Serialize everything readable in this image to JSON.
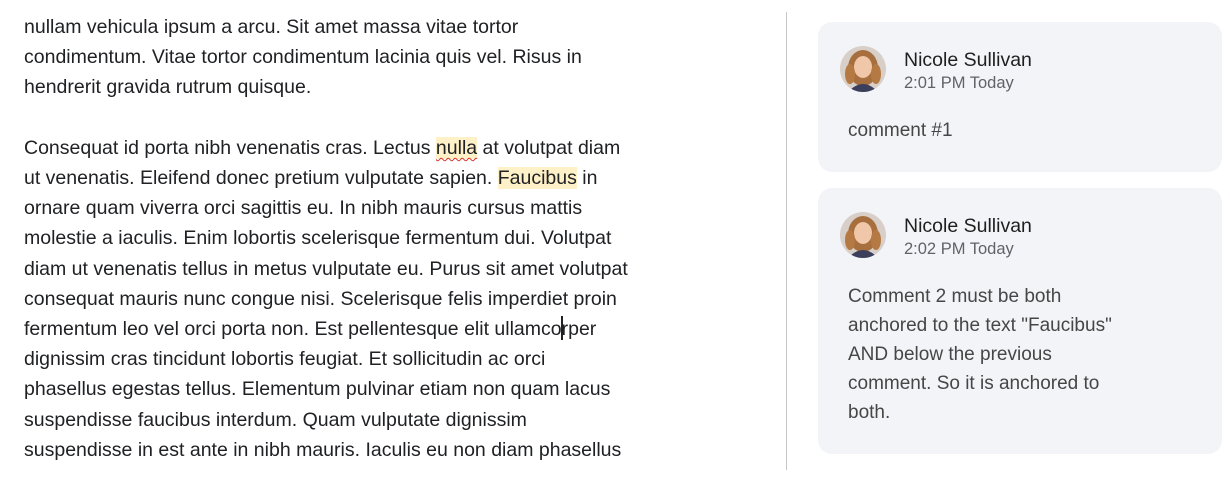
{
  "document": {
    "paragraph1_lines": [
      "nullam vehicula ipsum a arcu. Sit amet massa vitae tortor",
      "condimentum. Vitae tortor condimentum lacinia quis vel. Risus in",
      "hendrerit gravida rutrum quisque."
    ],
    "paragraph2": {
      "line1_before": "Consequat id porta nibh venenatis cras. Lectus ",
      "line1_highlight": "nulla",
      "line1_after": " at volutpat diam",
      "line2_before": "ut venenatis. Eleifend donec pretium vulputate sapien. ",
      "line2_highlight": "Faucibus",
      "line2_after": " in",
      "middle_lines": [
        "ornare quam viverra orci sagittis eu. In nibh mauris cursus mattis",
        "molestie a iaculis. Enim lobortis scelerisque fermentum dui. Volutpat",
        "diam ut venenatis tellus in metus vulputate eu. Purus sit amet volutpat",
        "consequat mauris nunc congue nisi. Scelerisque felis imperdiet proin"
      ],
      "caret_line_before": "fermentum leo vel orci porta non. Est pellentesque elit ullamco",
      "caret_line_after": "rper",
      "end_lines": [
        "dignissim cras tincidunt lobortis feugiat. Et sollicitudin ac orci",
        "phasellus egestas tellus. Elementum pulvinar etiam non quam lacus",
        "suspendisse faucibus interdum. Quam vulputate dignissim",
        "suspendisse in est ante in nibh mauris. Iaculis eu non diam phasellus"
      ]
    }
  },
  "comments": [
    {
      "author": "Nicole Sullivan",
      "time": "2:01 PM Today",
      "body_lines": [
        "comment #1"
      ]
    },
    {
      "author": "Nicole Sullivan",
      "time": "2:02 PM Today",
      "body_lines": [
        "Comment 2 must be both",
        "anchored to the text \"Faucibus\"",
        "AND below the previous",
        "comment. So it is anchored to",
        "both."
      ]
    }
  ],
  "colors": {
    "highlight": "#fef0c7",
    "card_background": "#f3f4f8",
    "spellcheck_underline": "#d93025"
  }
}
